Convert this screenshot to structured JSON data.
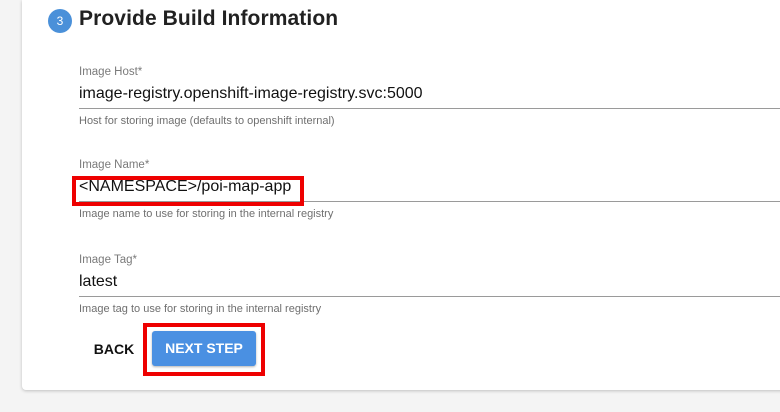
{
  "step": {
    "number": "3",
    "title": "Provide Build Information"
  },
  "fields": {
    "image_host": {
      "label": "Image Host*",
      "value": "image-registry.openshift-image-registry.svc:5000",
      "help": "Host for storing image (defaults to openshift internal)"
    },
    "image_name": {
      "label": "Image Name*",
      "value": "<NAMESPACE>/poi-map-app",
      "help": "Image name to use for storing in the internal registry"
    },
    "image_tag": {
      "label": "Image Tag*",
      "value": "latest",
      "help": "Image tag to use for storing in the internal registry"
    }
  },
  "actions": {
    "back_label": "BACK",
    "next_label": "NEXT STEP"
  },
  "colors": {
    "accent": "#4a90e2",
    "highlight": "#ee0000"
  }
}
